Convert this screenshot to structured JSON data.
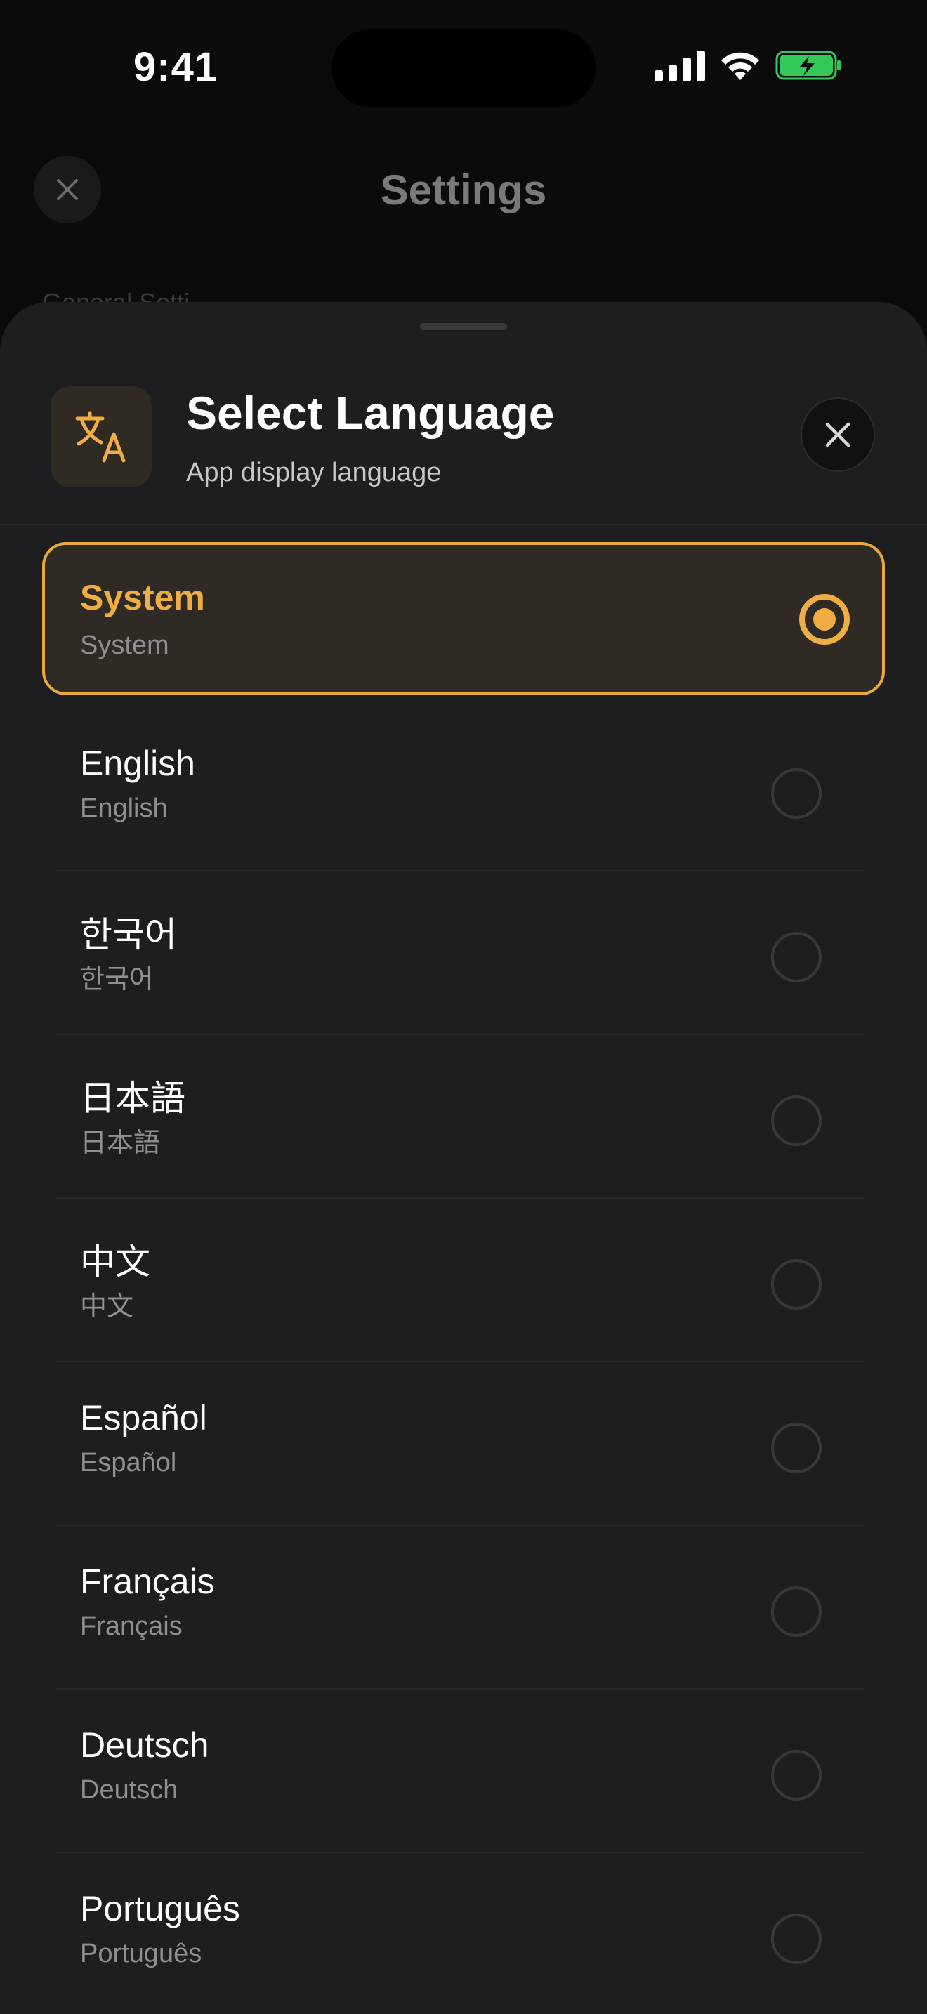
{
  "status_bar": {
    "time": "9:41",
    "icons": [
      "cellular-signal-icon",
      "wifi-icon",
      "battery-charging-icon"
    ],
    "battery_color": "#34c759"
  },
  "background_screen": {
    "title": "Settings",
    "section_label": "General Setti",
    "close_icon": "close-icon"
  },
  "sheet": {
    "icon": "translate-icon",
    "title": "Select Language",
    "subtitle": "App display language",
    "close_icon": "close-icon",
    "accent_color": "#f0ad43",
    "languages": [
      {
        "name": "System",
        "native": "System",
        "selected": true
      },
      {
        "name": "English",
        "native": "English",
        "selected": false
      },
      {
        "name": "한국어",
        "native": "한국어",
        "selected": false
      },
      {
        "name": "日本語",
        "native": "日本語",
        "selected": false
      },
      {
        "name": "中文",
        "native": "中文",
        "selected": false
      },
      {
        "name": "Español",
        "native": "Español",
        "selected": false
      },
      {
        "name": "Français",
        "native": "Français",
        "selected": false
      },
      {
        "name": "Deutsch",
        "native": "Deutsch",
        "selected": false
      },
      {
        "name": "Português",
        "native": "Português",
        "selected": false
      }
    ]
  }
}
